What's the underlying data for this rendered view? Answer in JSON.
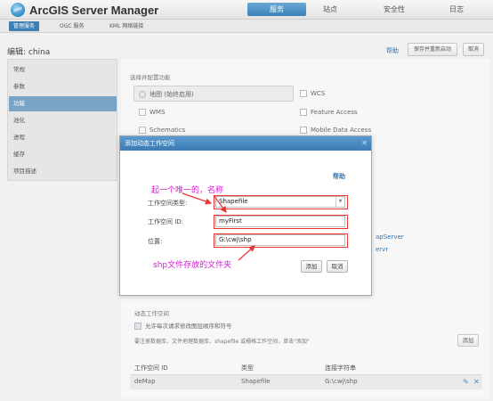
{
  "app": {
    "title": "ArcGIS Server Manager",
    "logo_icon": "globe-icon"
  },
  "top_tabs": [
    {
      "label": "服务",
      "active": true
    },
    {
      "label": "站点",
      "active": false
    },
    {
      "label": "安全性",
      "active": false
    },
    {
      "label": "日志",
      "active": false
    }
  ],
  "sub_tabs": [
    {
      "label": "管理服务",
      "active": true
    },
    {
      "label": "OGC 服务",
      "active": false
    },
    {
      "label": "KML 网络链接",
      "active": false
    }
  ],
  "page": {
    "heading": "编辑: china",
    "help": "帮助",
    "save_restart": "保存并重新启动",
    "cancel": "取消"
  },
  "sidebar": {
    "items": [
      {
        "label": "常规",
        "active": false
      },
      {
        "label": "参数",
        "active": false
      },
      {
        "label": "功能",
        "active": true
      },
      {
        "label": "池化",
        "active": false
      },
      {
        "label": "进程",
        "active": false
      },
      {
        "label": "缓存",
        "active": false
      },
      {
        "label": "项目描述",
        "active": false
      }
    ]
  },
  "features": {
    "title": "选择并配置功能",
    "left": [
      "地图 (始终启用)",
      "WMS",
      "Schematics"
    ],
    "right": [
      "WCS",
      "Feature Access",
      "Mobile Data Access"
    ]
  },
  "links": {
    "link1": "apServer",
    "link2": "ervr"
  },
  "dialog": {
    "title": "添加动态工作空间",
    "close_icon": "close-icon",
    "help": "帮助",
    "type_label": "工作空间类型:",
    "type_value": "Shapefile",
    "id_label": "工作空间 ID:",
    "id_value": "myFirst",
    "location_label": "位置:",
    "location_value": "G:\\cwj\\shp",
    "add": "添加",
    "cancel": "取消"
  },
  "annotations": {
    "note_name": "起一个唯一的，名称",
    "note_folder": "shp文件存放的文件夹"
  },
  "dynamic_workspace": {
    "section_title": "动态工作空间",
    "allow_checkbox": "允许每次请求修改图层顺序和符号",
    "hint": "要注册数据库、文件地理数据库、shapefile 或栅格工作空间，单击\"添加\"",
    "add": "添加",
    "columns": [
      "工作空间 ID",
      "类型",
      "连接字符串"
    ],
    "rows": [
      {
        "id": "deMap",
        "type": "Shapefile",
        "conn": "G:\\cwj\\shp"
      }
    ],
    "edit_icon": "pencil-icon",
    "delete_icon": "close-icon"
  }
}
